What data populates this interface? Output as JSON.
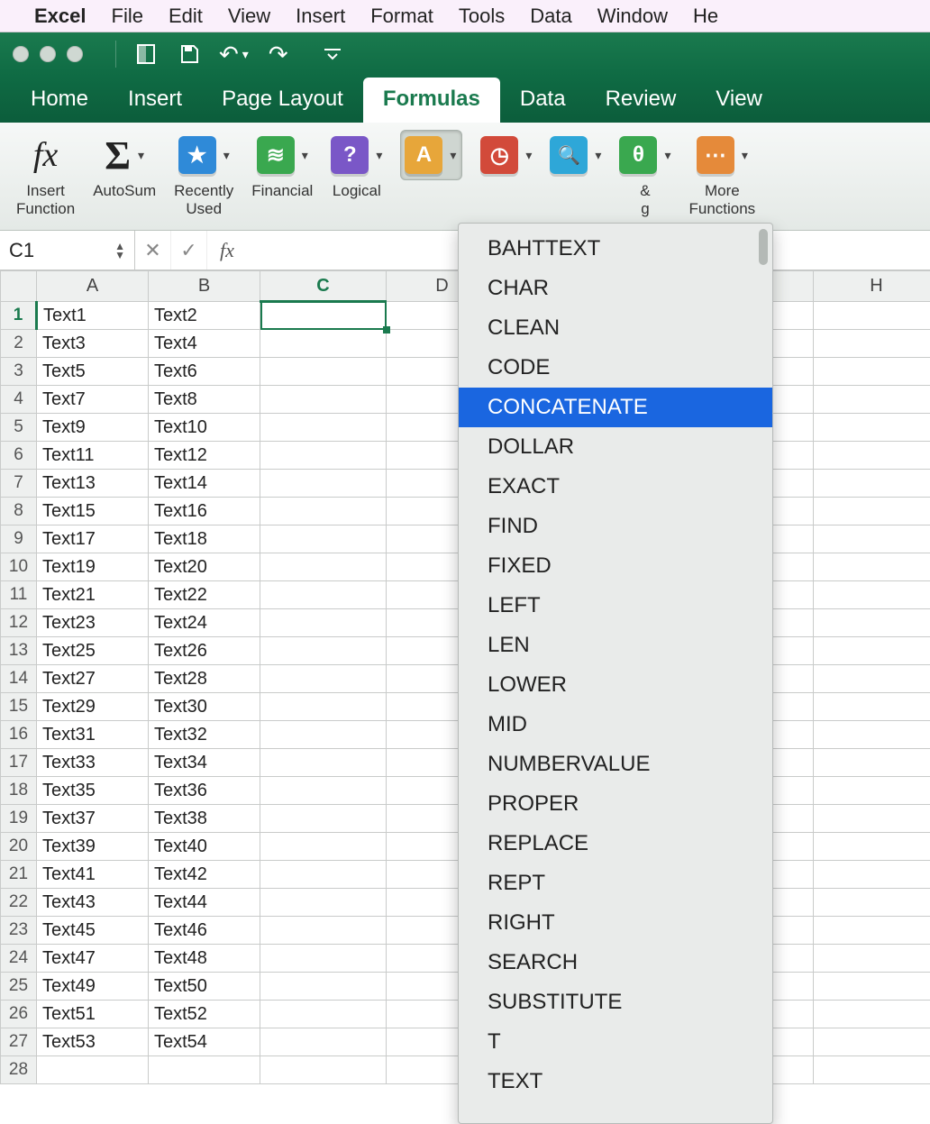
{
  "mac_menu": {
    "app": "Excel",
    "items": [
      "File",
      "Edit",
      "View",
      "Insert",
      "Format",
      "Tools",
      "Data",
      "Window",
      "He"
    ]
  },
  "ribbon_tabs": [
    "Home",
    "Insert",
    "Page Layout",
    "Formulas",
    "Data",
    "Review",
    "View"
  ],
  "ribbon_active_tab": "Formulas",
  "ribbon_groups": {
    "insert_function": "Insert\nFunction",
    "autosum": "AutoSum",
    "recently_used": "Recently\nUsed",
    "financial": "Financial",
    "logical": "Logical",
    "text": "",
    "date_time": "",
    "lookup": "",
    "math_trig_suffix": "&\ng",
    "more_functions": "More\nFunctions"
  },
  "ribbon_icons": {
    "recently_used": "★",
    "financial": "≋",
    "logical": "?",
    "text": "A",
    "date_time": "◷",
    "lookup": "🔍",
    "math_trig": "θ",
    "more": "⋯"
  },
  "name_box": "C1",
  "formula_value": "",
  "columns": [
    "A",
    "B",
    "C",
    "D",
    "H"
  ],
  "selected_column": "C",
  "selected_row": 1,
  "rows": [
    {
      "n": 1,
      "a": "Text1",
      "b": "Text2"
    },
    {
      "n": 2,
      "a": "Text3",
      "b": "Text4"
    },
    {
      "n": 3,
      "a": "Text5",
      "b": "Text6"
    },
    {
      "n": 4,
      "a": "Text7",
      "b": "Text8"
    },
    {
      "n": 5,
      "a": "Text9",
      "b": "Text10"
    },
    {
      "n": 6,
      "a": "Text11",
      "b": "Text12"
    },
    {
      "n": 7,
      "a": "Text13",
      "b": "Text14"
    },
    {
      "n": 8,
      "a": "Text15",
      "b": "Text16"
    },
    {
      "n": 9,
      "a": "Text17",
      "b": "Text18"
    },
    {
      "n": 10,
      "a": "Text19",
      "b": "Text20"
    },
    {
      "n": 11,
      "a": "Text21",
      "b": "Text22"
    },
    {
      "n": 12,
      "a": "Text23",
      "b": "Text24"
    },
    {
      "n": 13,
      "a": "Text25",
      "b": "Text26"
    },
    {
      "n": 14,
      "a": "Text27",
      "b": "Text28"
    },
    {
      "n": 15,
      "a": "Text29",
      "b": "Text30"
    },
    {
      "n": 16,
      "a": "Text31",
      "b": "Text32"
    },
    {
      "n": 17,
      "a": "Text33",
      "b": "Text34"
    },
    {
      "n": 18,
      "a": "Text35",
      "b": "Text36"
    },
    {
      "n": 19,
      "a": "Text37",
      "b": "Text38"
    },
    {
      "n": 20,
      "a": "Text39",
      "b": "Text40"
    },
    {
      "n": 21,
      "a": "Text41",
      "b": "Text42"
    },
    {
      "n": 22,
      "a": "Text43",
      "b": "Text44"
    },
    {
      "n": 23,
      "a": "Text45",
      "b": "Text46"
    },
    {
      "n": 24,
      "a": "Text47",
      "b": "Text48"
    },
    {
      "n": 25,
      "a": "Text49",
      "b": "Text50"
    },
    {
      "n": 26,
      "a": "Text51",
      "b": "Text52"
    },
    {
      "n": 27,
      "a": "Text53",
      "b": "Text54"
    },
    {
      "n": 28,
      "a": "",
      "b": ""
    }
  ],
  "text_functions": [
    "BAHTTEXT",
    "CHAR",
    "CLEAN",
    "CODE",
    "CONCATENATE",
    "DOLLAR",
    "EXACT",
    "FIND",
    "FIXED",
    "LEFT",
    "LEN",
    "LOWER",
    "MID",
    "NUMBERVALUE",
    "PROPER",
    "REPLACE",
    "REPT",
    "RIGHT",
    "SEARCH",
    "SUBSTITUTE",
    "T",
    "TEXT"
  ],
  "text_functions_selected": "CONCATENATE"
}
